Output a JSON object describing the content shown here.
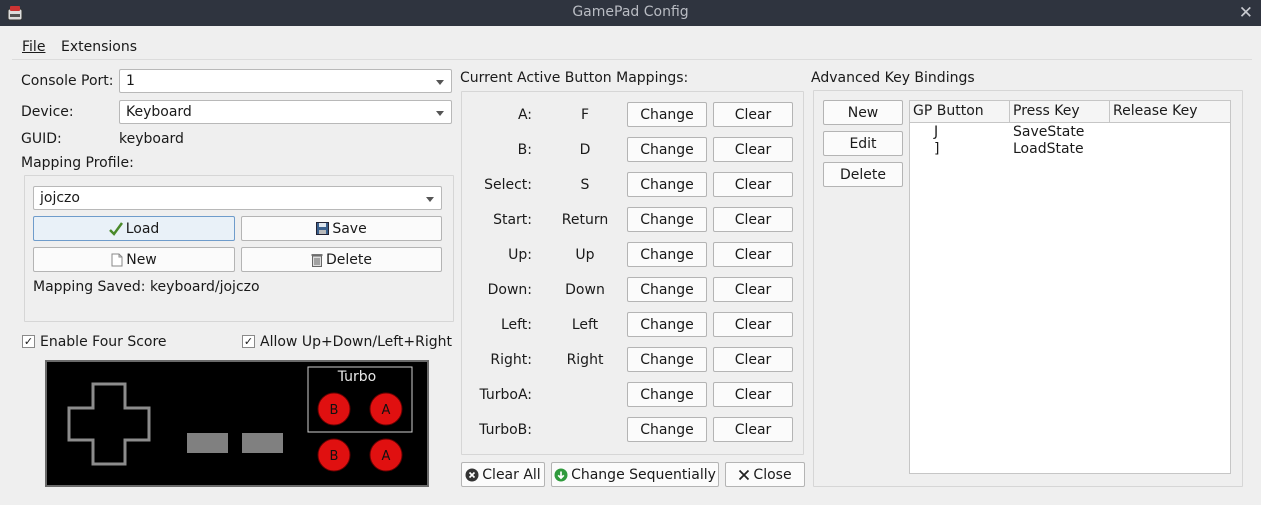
{
  "window": {
    "title": "GamePad Config"
  },
  "menu": [
    {
      "label": "File"
    },
    {
      "label": "Extensions"
    }
  ],
  "left": {
    "console_port_label": "Console Port:",
    "console_port_value": "1",
    "device_label": "Device:",
    "device_value": "Keyboard",
    "guid_label": "GUID:",
    "guid_value": "keyboard",
    "profile_label": "Mapping Profile:",
    "profile_value": "jojczo",
    "load": "Load",
    "save": "Save",
    "new": "New",
    "delete": "Delete",
    "status": "Mapping Saved: keyboard/jojczo",
    "four_score_label": "Enable Four Score",
    "four_score_checked": true,
    "allow_label": "Allow Up+Down/Left+Right",
    "allow_checked": true
  },
  "controller": {
    "turbo_label": "Turbo",
    "btn_b": "B",
    "btn_a": "A",
    "button_color": "#e01010"
  },
  "mappings": {
    "title": "Current Active Button Mappings:",
    "change_label": "Change",
    "clear_label": "Clear",
    "rows": [
      {
        "label": "A:",
        "key": "F"
      },
      {
        "label": "B:",
        "key": "D"
      },
      {
        "label": "Select:",
        "key": "S"
      },
      {
        "label": "Start:",
        "key": "Return"
      },
      {
        "label": "Up:",
        "key": "Up"
      },
      {
        "label": "Down:",
        "key": "Down"
      },
      {
        "label": "Left:",
        "key": "Left"
      },
      {
        "label": "Right:",
        "key": "Right"
      },
      {
        "label": "TurboA:",
        "key": ""
      },
      {
        "label": "TurboB:",
        "key": ""
      }
    ],
    "clear_all": "Clear All",
    "change_seq": "Change Sequentially",
    "close": "Close"
  },
  "advanced": {
    "title": "Advanced Key Bindings",
    "new": "New",
    "edit": "Edit",
    "delete": "Delete",
    "columns": [
      "GP Button",
      "Press Key",
      "Release Key"
    ],
    "rows": [
      {
        "button": "J",
        "press": "SaveState",
        "release": ""
      },
      {
        "button": "]",
        "press": "LoadState",
        "release": ""
      }
    ]
  }
}
